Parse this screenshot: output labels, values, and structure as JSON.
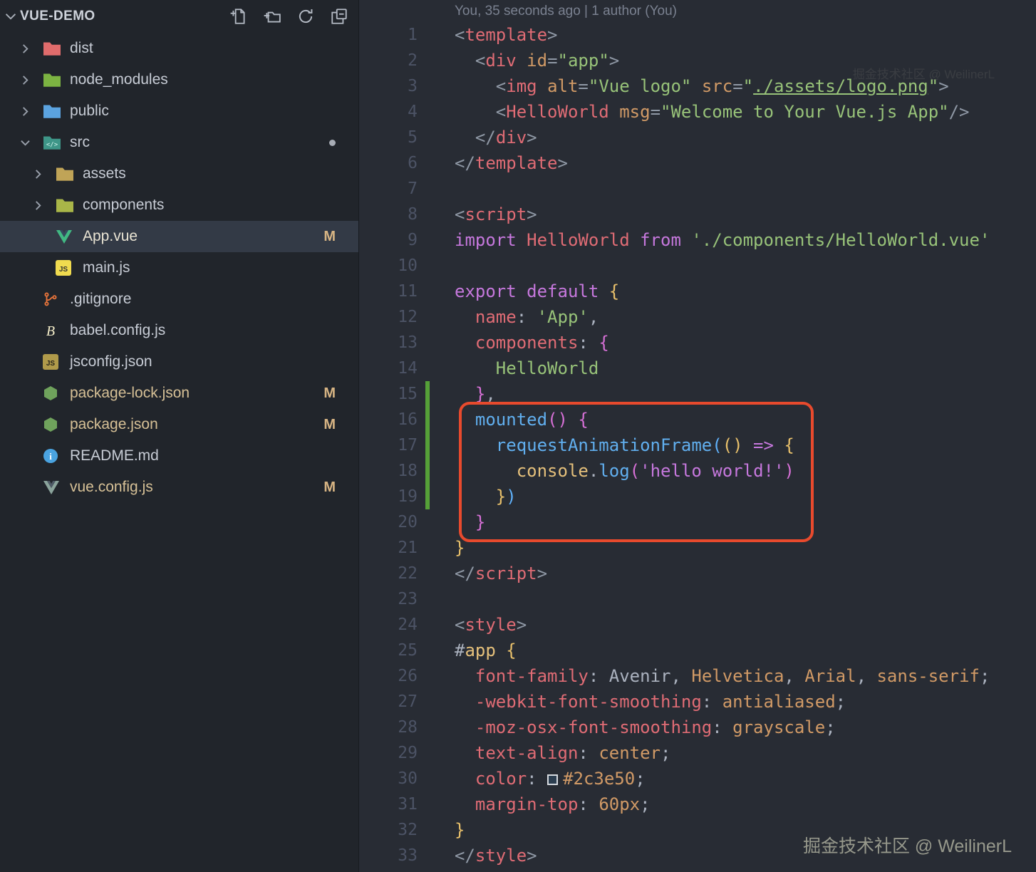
{
  "explorer": {
    "title": "VUE-DEMO",
    "actions": [
      {
        "name": "new-file"
      },
      {
        "name": "new-folder"
      },
      {
        "name": "refresh-explorer"
      },
      {
        "name": "collapse-folders"
      }
    ],
    "items": [
      {
        "label": "dist",
        "level": 1,
        "chevron": "right",
        "icon": "folder",
        "icon_color": "#e06c6c",
        "badge": "",
        "selected": false,
        "dot": false,
        "modified": false
      },
      {
        "label": "node_modules",
        "level": 1,
        "chevron": "right",
        "icon": "folder",
        "icon_color": "#7cb342",
        "badge": "",
        "selected": false,
        "dot": false,
        "modified": false
      },
      {
        "label": "public",
        "level": 1,
        "chevron": "right",
        "icon": "folder",
        "icon_color": "#5ba3e0",
        "badge": "",
        "selected": false,
        "dot": false,
        "modified": false
      },
      {
        "label": "src",
        "level": 1,
        "chevron": "down",
        "icon": "folder-code",
        "icon_color": "#3e9688",
        "badge": "",
        "selected": false,
        "dot": true,
        "modified": false
      },
      {
        "label": "assets",
        "level": 2,
        "chevron": "right",
        "icon": "folder",
        "icon_color": "#c0a457",
        "badge": "",
        "selected": false,
        "dot": false,
        "modified": false
      },
      {
        "label": "components",
        "level": 2,
        "chevron": "right",
        "icon": "folder",
        "icon_color": "#a9b648",
        "badge": "",
        "selected": false,
        "dot": false,
        "modified": false
      },
      {
        "label": "App.vue",
        "level": 2,
        "chevron": "none",
        "icon": "vue",
        "icon_color": "#41b883",
        "badge": "M",
        "selected": true,
        "dot": false,
        "modified": false
      },
      {
        "label": "main.js",
        "level": 2,
        "chevron": "none",
        "icon": "js",
        "icon_color": "#f0db4f",
        "badge": "",
        "selected": false,
        "dot": false,
        "modified": false
      },
      {
        "label": ".gitignore",
        "level": 1,
        "chevron": "none",
        "icon": "git",
        "icon_color": "#e8743b",
        "badge": "",
        "selected": false,
        "dot": false,
        "modified": false
      },
      {
        "label": "babel.config.js",
        "level": 1,
        "chevron": "none",
        "icon": "babel",
        "icon_color": "#f3ecc8",
        "badge": "",
        "selected": false,
        "dot": false,
        "modified": false
      },
      {
        "label": "jsconfig.json",
        "level": 1,
        "chevron": "none",
        "icon": "jsconfig",
        "icon_color": "#b09a4a",
        "badge": "",
        "selected": false,
        "dot": false,
        "modified": false
      },
      {
        "label": "package-lock.json",
        "level": 1,
        "chevron": "none",
        "icon": "node",
        "icon_color": "#6fa25c",
        "badge": "M",
        "selected": false,
        "dot": false,
        "modified": true
      },
      {
        "label": "package.json",
        "level": 1,
        "chevron": "none",
        "icon": "node",
        "icon_color": "#6fa25c",
        "badge": "M",
        "selected": false,
        "dot": false,
        "modified": true
      },
      {
        "label": "README.md",
        "level": 1,
        "chevron": "none",
        "icon": "info",
        "icon_color": "#4aa3e0",
        "badge": "",
        "selected": false,
        "dot": false,
        "modified": false
      },
      {
        "label": "vue.config.js",
        "level": 1,
        "chevron": "none",
        "icon": "vue-gray",
        "icon_color": "#8aa39b",
        "badge": "M",
        "selected": false,
        "dot": false,
        "modified": true
      }
    ]
  },
  "editor": {
    "blame": "You, 35 seconds ago | 1 author (You)",
    "lines": [
      [
        [
          "p",
          "<"
        ],
        [
          "t",
          "template"
        ],
        [
          "p",
          ">"
        ]
      ],
      [
        [
          "w",
          "  "
        ],
        [
          "p",
          "<"
        ],
        [
          "t",
          "div"
        ],
        [
          "w",
          " "
        ],
        [
          "a",
          "id"
        ],
        [
          "p",
          "="
        ],
        [
          "s",
          "\"app\""
        ],
        [
          "p",
          ">"
        ]
      ],
      [
        [
          "w",
          "    "
        ],
        [
          "p",
          "<"
        ],
        [
          "t",
          "img"
        ],
        [
          "w",
          " "
        ],
        [
          "a",
          "alt"
        ],
        [
          "p",
          "="
        ],
        [
          "s",
          "\"Vue logo\""
        ],
        [
          "w",
          " "
        ],
        [
          "a",
          "src"
        ],
        [
          "p",
          "="
        ],
        [
          "s",
          "\""
        ],
        [
          "u",
          "./assets/logo.png"
        ],
        [
          "s",
          "\""
        ],
        [
          "p",
          ">"
        ]
      ],
      [
        [
          "w",
          "    "
        ],
        [
          "p",
          "<"
        ],
        [
          "t",
          "HelloWorld"
        ],
        [
          "w",
          " "
        ],
        [
          "a",
          "msg"
        ],
        [
          "p",
          "="
        ],
        [
          "s",
          "\"Welcome to Your Vue.js App\""
        ],
        [
          "p",
          "/>"
        ]
      ],
      [
        [
          "w",
          "  "
        ],
        [
          "p",
          "</"
        ],
        [
          "t",
          "div"
        ],
        [
          "p",
          ">"
        ]
      ],
      [
        [
          "p",
          "</"
        ],
        [
          "t",
          "template"
        ],
        [
          "p",
          ">"
        ]
      ],
      [],
      [
        [
          "p",
          "<"
        ],
        [
          "t",
          "script"
        ],
        [
          "p",
          ">"
        ]
      ],
      [
        [
          "k",
          "import"
        ],
        [
          "w",
          " "
        ],
        [
          "t",
          "HelloWorld"
        ],
        [
          "w",
          " "
        ],
        [
          "k",
          "from"
        ],
        [
          "w",
          " "
        ],
        [
          "s",
          "'./components/HelloWorld.vue'"
        ]
      ],
      [],
      [
        [
          "k",
          "export"
        ],
        [
          "w",
          " "
        ],
        [
          "k",
          "default"
        ],
        [
          "w",
          " "
        ],
        [
          "b1",
          "{"
        ]
      ],
      [
        [
          "w",
          "  "
        ],
        [
          "t",
          "name"
        ],
        [
          "w",
          ": "
        ],
        [
          "s",
          "'App'"
        ],
        [
          "w",
          ","
        ]
      ],
      [
        [
          "w",
          "  "
        ],
        [
          "t",
          "components"
        ],
        [
          "w",
          ": "
        ],
        [
          "b2",
          "{"
        ]
      ],
      [
        [
          "w",
          "    "
        ],
        [
          "s",
          "HelloWorld"
        ]
      ],
      [
        [
          "w",
          "  "
        ],
        [
          "b2",
          "}"
        ],
        [
          "w",
          ","
        ]
      ],
      [
        [
          "w",
          "  "
        ],
        [
          "f",
          "mounted"
        ],
        [
          "b2",
          "()"
        ],
        [
          "w",
          " "
        ],
        [
          "b2",
          "{"
        ]
      ],
      [
        [
          "w",
          "    "
        ],
        [
          "f",
          "requestAnimationFrame"
        ],
        [
          "b3",
          "("
        ],
        [
          "b1",
          "()"
        ],
        [
          "w",
          " "
        ],
        [
          "k",
          "=>"
        ],
        [
          "w",
          " "
        ],
        [
          "b1",
          "{"
        ]
      ],
      [
        [
          "w",
          "      "
        ],
        [
          "y",
          "console"
        ],
        [
          "w",
          "."
        ],
        [
          "f",
          "log"
        ],
        [
          "b2",
          "("
        ],
        [
          "ps",
          "'hello world!'"
        ],
        [
          "b2",
          ")"
        ]
      ],
      [
        [
          "w",
          "    "
        ],
        [
          "b1",
          "}"
        ],
        [
          "b3",
          ")"
        ]
      ],
      [
        [
          "w",
          "  "
        ],
        [
          "b2",
          "}"
        ]
      ],
      [
        [
          "b1",
          "}"
        ]
      ],
      [
        [
          "p",
          "</"
        ],
        [
          "t",
          "script"
        ],
        [
          "p",
          ">"
        ]
      ],
      [],
      [
        [
          "p",
          "<"
        ],
        [
          "t",
          "style"
        ],
        [
          "p",
          ">"
        ]
      ],
      [
        [
          "w",
          "#"
        ],
        [
          "y",
          "app"
        ],
        [
          "w",
          " "
        ],
        [
          "b1",
          "{"
        ]
      ],
      [
        [
          "w",
          "  "
        ],
        [
          "t",
          "font-family"
        ],
        [
          "w",
          ": "
        ],
        [
          "w",
          "Avenir"
        ],
        [
          "w",
          ", "
        ],
        [
          "a",
          "Helvetica"
        ],
        [
          "w",
          ", "
        ],
        [
          "a",
          "Arial"
        ],
        [
          "w",
          ", "
        ],
        [
          "a",
          "sans-serif"
        ],
        [
          "w",
          ";"
        ]
      ],
      [
        [
          "w",
          "  "
        ],
        [
          "t",
          "-webkit-font-smoothing"
        ],
        [
          "w",
          ": "
        ],
        [
          "a",
          "antialiased"
        ],
        [
          "w",
          ";"
        ]
      ],
      [
        [
          "w",
          "  "
        ],
        [
          "t",
          "-moz-osx-font-smoothing"
        ],
        [
          "w",
          ": "
        ],
        [
          "a",
          "grayscale"
        ],
        [
          "w",
          ";"
        ]
      ],
      [
        [
          "w",
          "  "
        ],
        [
          "t",
          "text-align"
        ],
        [
          "w",
          ": "
        ],
        [
          "a",
          "center"
        ],
        [
          "w",
          ";"
        ]
      ],
      [
        [
          "w",
          "  "
        ],
        [
          "t",
          "color"
        ],
        [
          "w",
          ": "
        ],
        [
          "sw",
          ""
        ],
        [
          "a",
          "#2c3e50"
        ],
        [
          "w",
          ";"
        ]
      ],
      [
        [
          "w",
          "  "
        ],
        [
          "t",
          "margin-top"
        ],
        [
          "w",
          ": "
        ],
        [
          "a",
          "60px"
        ],
        [
          "w",
          ";"
        ]
      ],
      [
        [
          "b1",
          "}"
        ]
      ],
      [
        [
          "p",
          "</"
        ],
        [
          "t",
          "style"
        ],
        [
          "p",
          ">"
        ]
      ]
    ],
    "css_color_value": "#2c3e50"
  },
  "watermark": {
    "text": "掘金技术社区 @ WeilinerL"
  },
  "colors": {
    "annotation_box": "#e84a2d",
    "change_indicator": "#55a038",
    "modified_badge": "#d8b584",
    "selection_bg": "#333a46",
    "sidebar_bg": "#21252b",
    "editor_bg": "#282c34"
  }
}
